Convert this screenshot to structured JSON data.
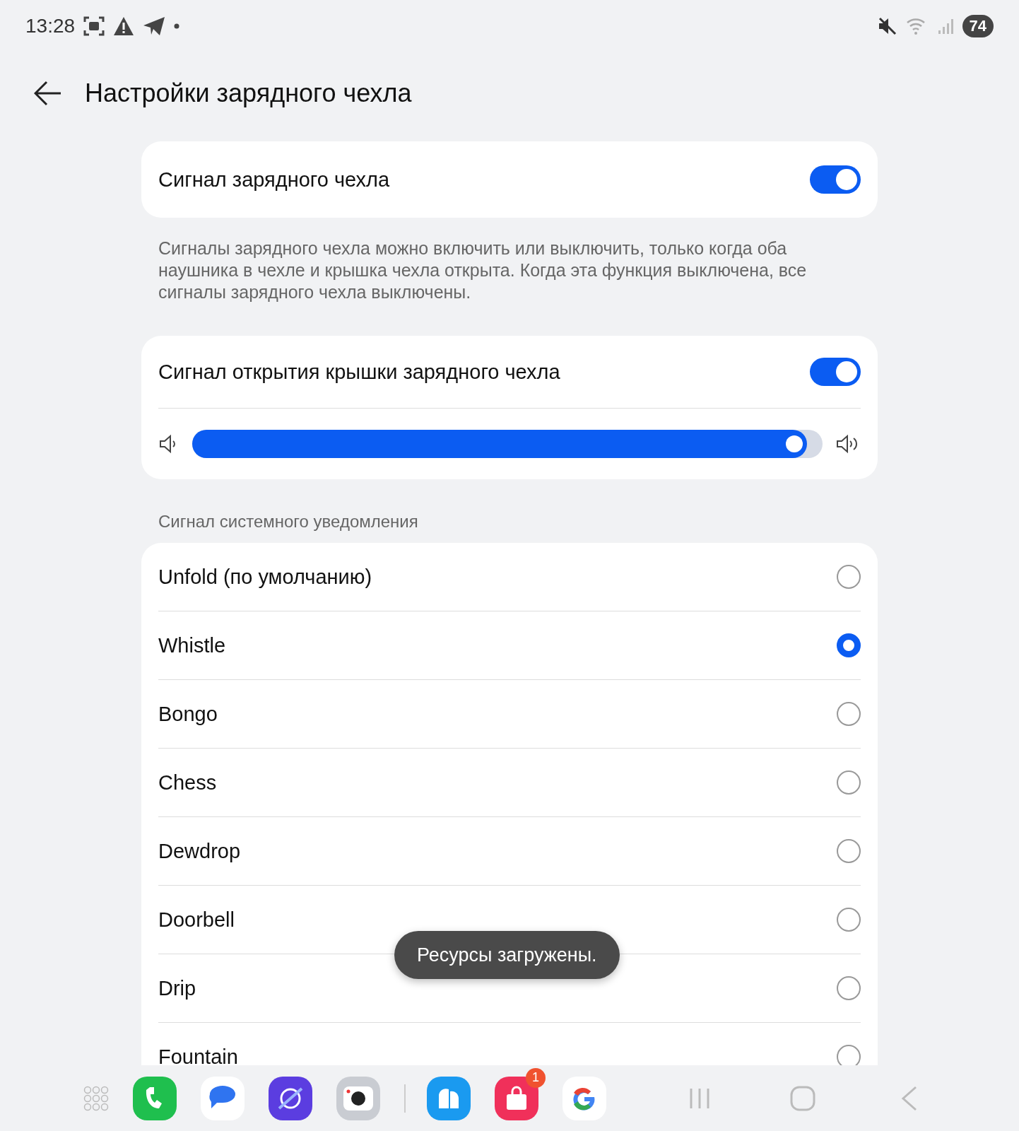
{
  "status_bar": {
    "time": "13:28",
    "battery": "74"
  },
  "header": {
    "title": "Настройки зарядного чехла"
  },
  "case_signal": {
    "label": "Сигнал зарядного чехла",
    "on": true,
    "description": "Сигналы зарядного чехла можно включить или выключить, только когда оба наушника в чехле и крышка чехла открыта. Когда эта функция выключена, все сигналы зарядного чехла выключены."
  },
  "lid_signal": {
    "label": "Сигнал открытия крышки зарядного чехла",
    "on": true,
    "volume": {
      "level": 0.975
    }
  },
  "sound_section": {
    "title": "Сигнал системного уведомления",
    "options": [
      {
        "label": "Unfold (по умолчанию)",
        "selected": false
      },
      {
        "label": "Whistle",
        "selected": true
      },
      {
        "label": "Bongo",
        "selected": false
      },
      {
        "label": "Chess",
        "selected": false
      },
      {
        "label": "Dewdrop",
        "selected": false
      },
      {
        "label": "Doorbell",
        "selected": false
      },
      {
        "label": "Drip",
        "selected": false
      },
      {
        "label": "Fountain",
        "selected": false
      }
    ]
  },
  "toast": {
    "text": "Ресурсы загружены."
  },
  "dock": {
    "apps": [
      {
        "kind": "phone"
      },
      {
        "kind": "messages"
      },
      {
        "kind": "browser"
      },
      {
        "kind": "camera"
      },
      {
        "kind": "notes"
      },
      {
        "kind": "store",
        "badge": "1"
      },
      {
        "kind": "google"
      }
    ]
  }
}
